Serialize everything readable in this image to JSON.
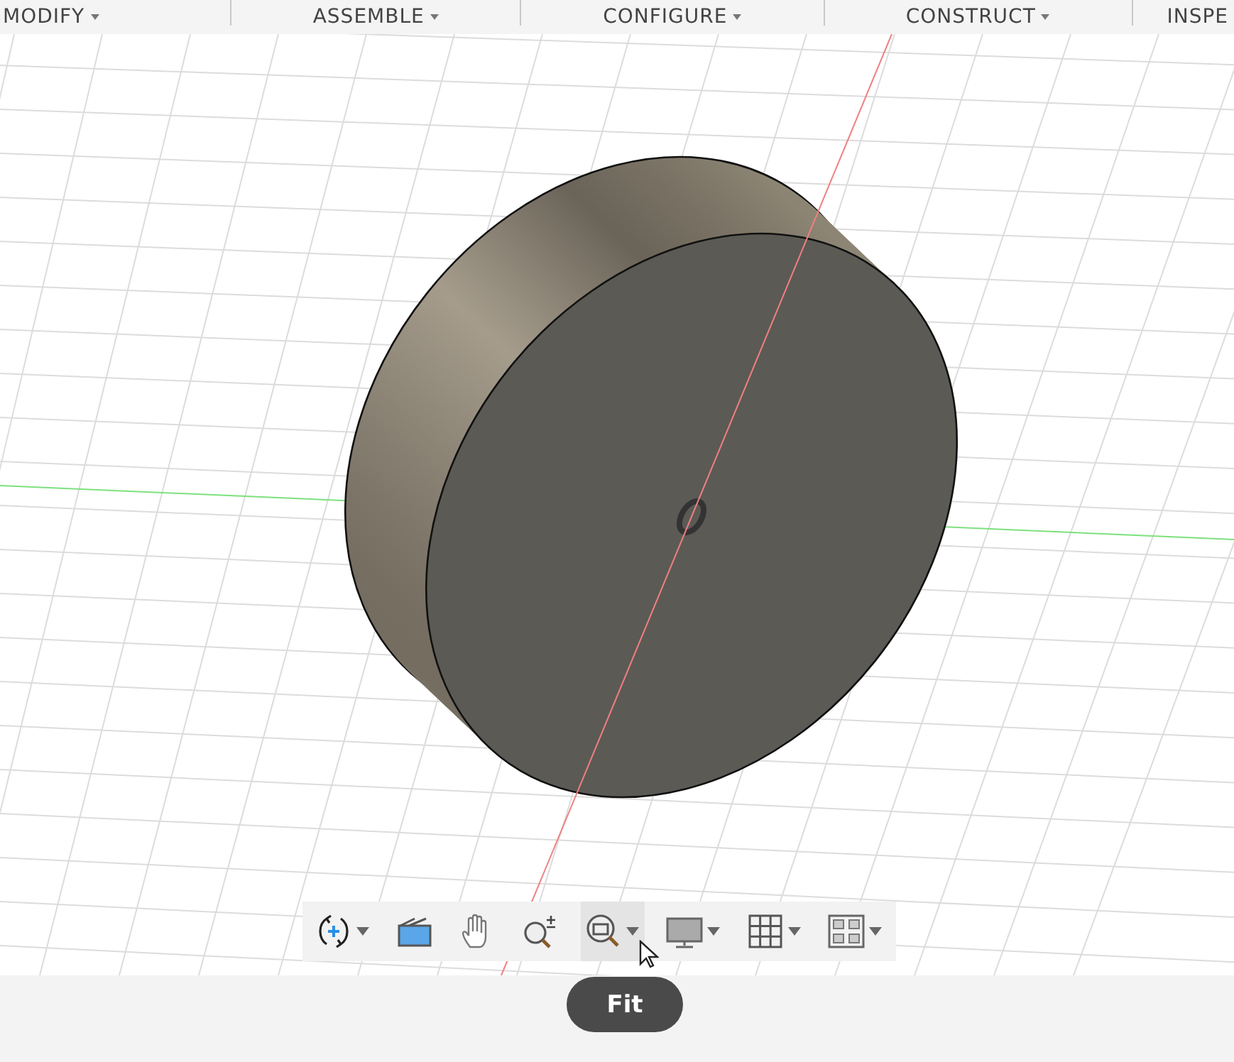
{
  "menu": [
    {
      "label": "MODIFY"
    },
    {
      "label": "ASSEMBLE"
    },
    {
      "label": "CONFIGURE"
    },
    {
      "label": "CONSTRUCT"
    },
    {
      "label": "INSPE"
    }
  ],
  "toolbar": [
    {
      "kind": "orbit",
      "selected": false,
      "dropdown": true
    },
    {
      "kind": "lookat",
      "selected": false,
      "dropdown": false
    },
    {
      "kind": "pan",
      "selected": false,
      "dropdown": false
    },
    {
      "kind": "zoom",
      "selected": false,
      "dropdown": false
    },
    {
      "kind": "fit",
      "selected": true,
      "dropdown": true
    },
    {
      "kind": "display",
      "selected": false,
      "dropdown": true
    },
    {
      "kind": "grid",
      "selected": false,
      "dropdown": true
    },
    {
      "kind": "viewports",
      "selected": false,
      "dropdown": true
    }
  ],
  "tooltip": "Fit"
}
